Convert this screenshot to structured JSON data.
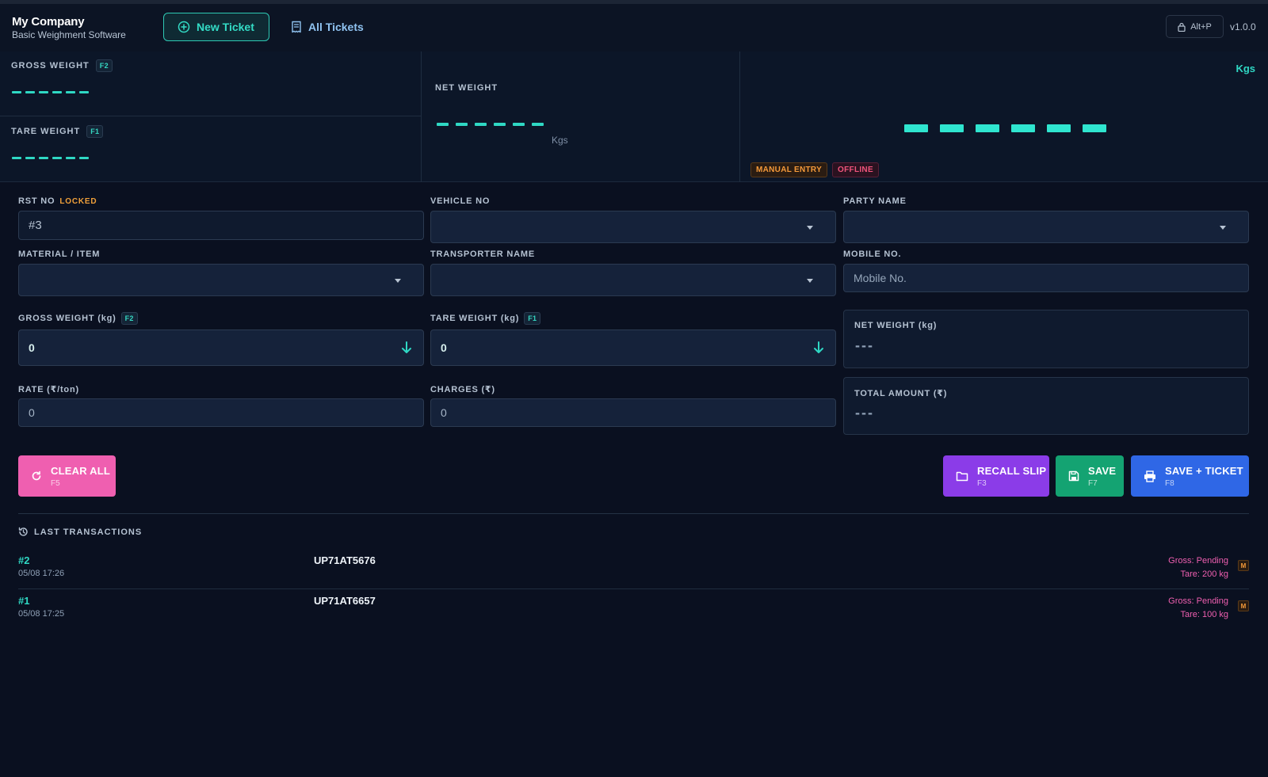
{
  "header": {
    "company": "My Company",
    "subtitle": "Basic Weighment Software",
    "nav_new_ticket": "New Ticket",
    "nav_all_tickets": "All Tickets",
    "hotkey": "Alt+P",
    "version": "v1.0.0"
  },
  "display": {
    "gross_label": "GROSS WEIGHT",
    "gross_key": "F2",
    "tare_label": "TARE WEIGHT",
    "tare_key": "F1",
    "net_label": "NET WEIGHT",
    "net_unit": "Kgs",
    "main_unit": "Kgs",
    "badge_manual": "MANUAL ENTRY",
    "badge_offline": "OFFLINE"
  },
  "form": {
    "rst_label": "RST NO",
    "rst_locked": "LOCKED",
    "rst_value": "#3",
    "vehicle_label": "VEHICLE NO",
    "party_label": "PARTY NAME",
    "material_label": "MATERIAL / ITEM",
    "transporter_label": "TRANSPORTER NAME",
    "mobile_label": "MOBILE NO.",
    "mobile_placeholder": "Mobile No.",
    "gross_label": "GROSS WEIGHT (kg)",
    "gross_key": "F2",
    "gross_value": "0",
    "tare_label": "TARE WEIGHT (kg)",
    "tare_key": "F1",
    "tare_value": "0",
    "net_label": "NET WEIGHT (kg)",
    "net_value": "---",
    "rate_label": "RATE (₹/ton)",
    "rate_value": "0",
    "charges_label": "CHARGES (₹)",
    "charges_value": "0",
    "total_label": "TOTAL AMOUNT (₹)",
    "total_value": "---"
  },
  "actions": {
    "clear_label": "CLEAR ALL",
    "clear_key": "F5",
    "recall_label": "RECALL SLIP",
    "recall_key": "F3",
    "save_label": "SAVE",
    "save_key": "F7",
    "save_ticket_label": "SAVE + TICKET",
    "save_ticket_key": "F8"
  },
  "transactions": {
    "title": "LAST TRANSACTIONS",
    "items": [
      {
        "id": "#2",
        "time": "05/08 17:26",
        "vehicle": "UP71AT5676",
        "gross": "Gross: Pending",
        "tare": "Tare: 200 kg",
        "mode": "M"
      },
      {
        "id": "#1",
        "time": "05/08 17:25",
        "vehicle": "UP71AT6657",
        "gross": "Gross: Pending",
        "tare": "Tare: 100 kg",
        "mode": "M"
      }
    ]
  },
  "colors": {
    "accent": "#2fd8c4",
    "clear": "#ef5fb0",
    "recall": "#8b3ce8",
    "save": "#14a372",
    "save_ticket": "#2f67e6"
  }
}
